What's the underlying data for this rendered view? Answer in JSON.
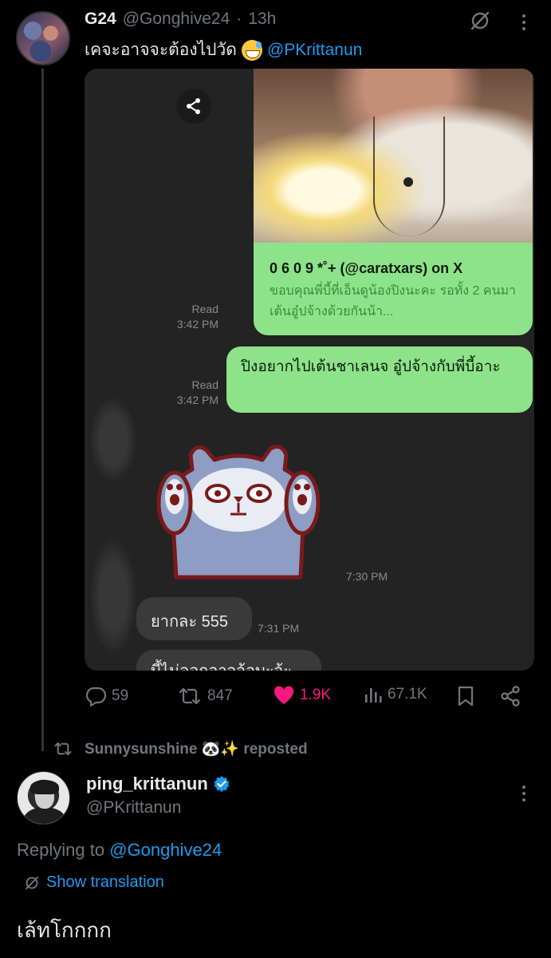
{
  "tweet": {
    "author_name": "G24",
    "author_handle": "@Gonghive24",
    "separator": "·",
    "time": "13h",
    "text_thai": "เคจะอาจจะต้องไปวัด",
    "text_mention": "@PKrittanun",
    "emoji": "grinning-face-with-sweat"
  },
  "media": {
    "link_card": {
      "title": "0 6 0 9 *˚+ (@caratxars) on X",
      "description": "ขอบคุณพี่บี้ที่เอ็นดูน้องปิงนะคะ รอทั้ง 2 คนมาเต้นอู๋ปจ้างด้วยกันน้า..."
    },
    "read1": {
      "label": "Read",
      "time": "3:42 PM"
    },
    "read2": {
      "label": "Read",
      "time": "3:42 PM"
    },
    "green_message": "ปิงอยากไปเต้นชาเลนจ อู๋ปจ้างกับพี่บี้อาะ",
    "sticker": "bear-sticker",
    "sticker_time": "7:30 PM",
    "gray_message": "ยากละ 555",
    "gray_time": "7:31 PM",
    "gray_message2": "บี้ไม่ลอกอาจจ้อบะจ้ะ"
  },
  "actions": {
    "replies": "59",
    "reposts": "847",
    "likes": "1.9K",
    "views": "67.1K"
  },
  "repost_banner": {
    "text": "Sunnysunshine 🐼✨ reposted"
  },
  "reply": {
    "author_name": "ping_krittanun",
    "author_handle": "@PKrittanun",
    "verified": true,
    "replying_prefix": "Replying to",
    "replying_to": "@Gonghive24",
    "show_translation": "Show translation",
    "text": "เล้ทโกกกก"
  },
  "colors": {
    "background": "#000000",
    "accent": "#1d9bf0",
    "like": "#f91880",
    "muted": "#71767b",
    "chat_green": "#8ee38a"
  }
}
